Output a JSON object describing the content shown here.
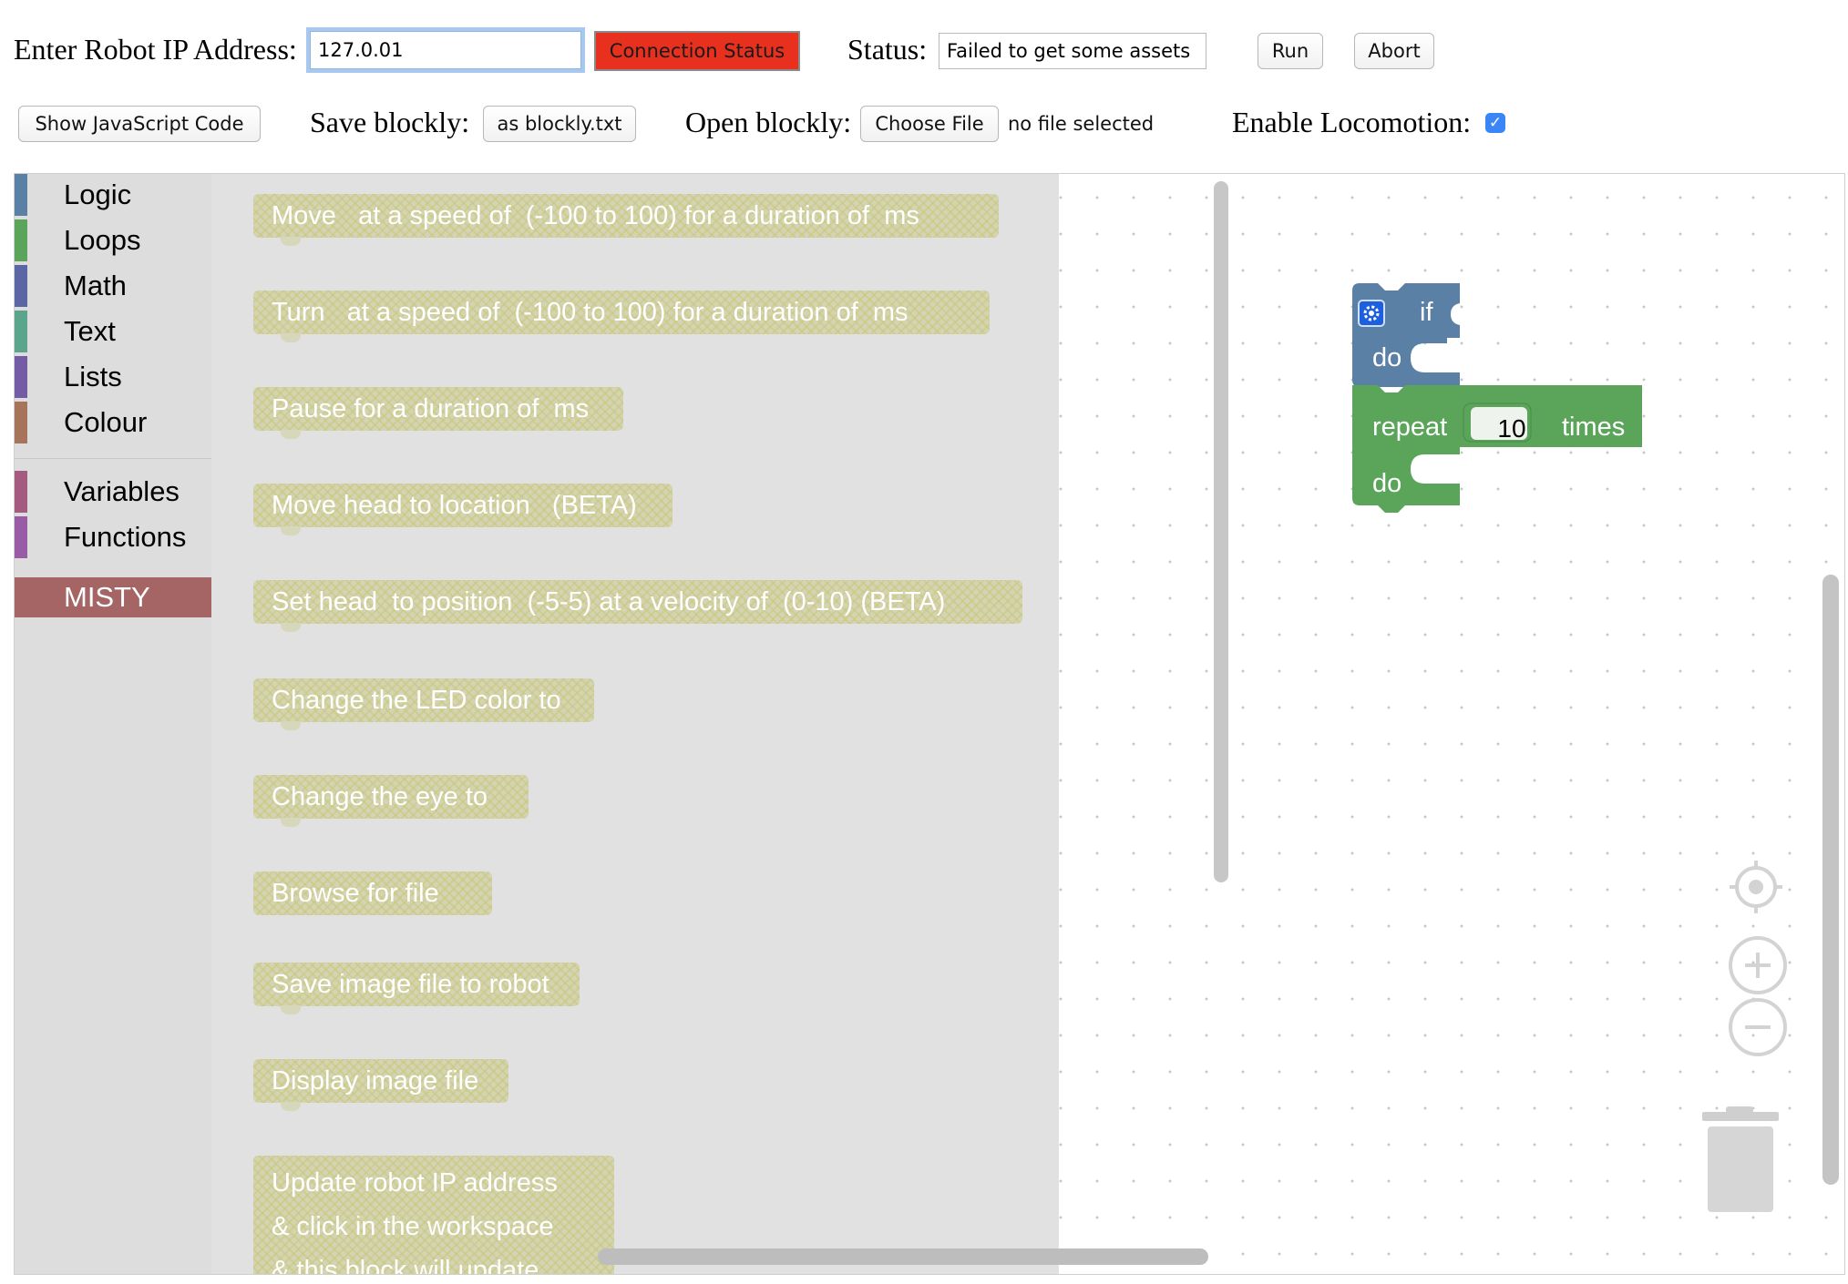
{
  "header": {
    "ip_label": "Enter Robot IP Address:",
    "ip_value": "127.0.01",
    "connection_button": "Connection Status",
    "status_label": "Status:",
    "status_value": "Failed to get some assets",
    "run_button": "Run",
    "abort_button": "Abort",
    "show_js_button": "Show JavaScript Code",
    "save_label": "Save blockly:",
    "save_button": "as blockly.txt",
    "open_label": "Open blockly:",
    "choose_file_button": "Choose File",
    "file_status": "no file selected",
    "locomotion_label": "Enable Locomotion:",
    "locomotion_checked": true,
    "connection_color": "#e8301f",
    "checkbox_color": "#3b86f6"
  },
  "toolbox": {
    "categories": [
      {
        "label": "Logic",
        "color": "#5b80a5"
      },
      {
        "label": "Loops",
        "color": "#5ba55b"
      },
      {
        "label": "Math",
        "color": "#5b67a5"
      },
      {
        "label": "Text",
        "color": "#5ba58c"
      },
      {
        "label": "Lists",
        "color": "#745ba5"
      },
      {
        "label": "Colour",
        "color": "#a5745b"
      },
      {
        "label": "Variables",
        "color": "#a55b80"
      },
      {
        "label": "Functions",
        "color": "#995ba5"
      }
    ],
    "selected": {
      "label": "MISTY",
      "color": "#a56565"
    }
  },
  "flyout": {
    "blocks": [
      "Move   at a speed of  (-100 to 100) for a duration of  ms",
      "Turn   at a speed of  (-100 to 100) for a duration of  ms",
      "Pause for a duration of  ms",
      "Move head to location   (BETA)",
      "Set head  to position  (-5-5) at a velocity of  (0-10) (BETA)",
      "Change the LED color to",
      "Change the eye to",
      "Browse for file",
      "Save image file to robot",
      "Display image file"
    ],
    "multiline_block": [
      "Update robot IP address",
      "& click in the workspace",
      "& this block will update"
    ]
  },
  "workspace": {
    "if_block": {
      "if_label": "if",
      "do_label": "do",
      "color": "#5b80a5"
    },
    "repeat_block": {
      "repeat_label": "repeat",
      "count": "10",
      "times_label": "times",
      "do_label": "do",
      "color": "#5ba55b"
    }
  }
}
